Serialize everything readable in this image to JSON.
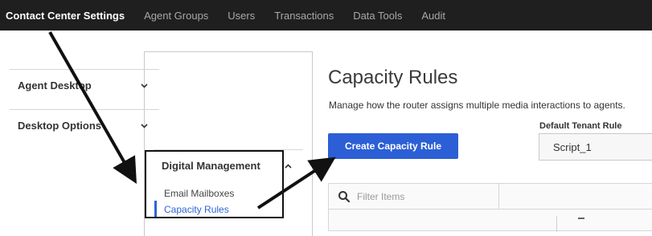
{
  "topnav": {
    "items": [
      {
        "label": "Contact Center Settings",
        "active": true
      },
      {
        "label": "Agent Groups",
        "active": false
      },
      {
        "label": "Users",
        "active": false
      },
      {
        "label": "Transactions",
        "active": false
      },
      {
        "label": "Data Tools",
        "active": false
      },
      {
        "label": "Audit",
        "active": false
      }
    ]
  },
  "sidebar": {
    "sections": [
      {
        "label": "Agent Desktop",
        "expanded": false,
        "icon": "chevron-down-icon"
      },
      {
        "label": "Desktop Options",
        "expanded": false,
        "icon": "chevron-down-icon"
      },
      {
        "label": "Digital Management",
        "expanded": true,
        "icon": "chevron-up-icon"
      }
    ],
    "sub_items": [
      {
        "label": "Email Mailboxes",
        "active": false
      },
      {
        "label": "Capacity Rules",
        "active": true
      }
    ]
  },
  "main": {
    "title": "Capacity Rules",
    "description": "Manage how the router assigns multiple media interactions to agents.",
    "create_button": "Create Capacity Rule",
    "tenant_rule_label": "Default Tenant Rule",
    "tenant_rule_value": "Script_1",
    "filter_placeholder": "Filter Items"
  },
  "colors": {
    "topnav_bg": "#1f1f1f",
    "accent": "#2c5fd5",
    "annotation": "#111111"
  }
}
